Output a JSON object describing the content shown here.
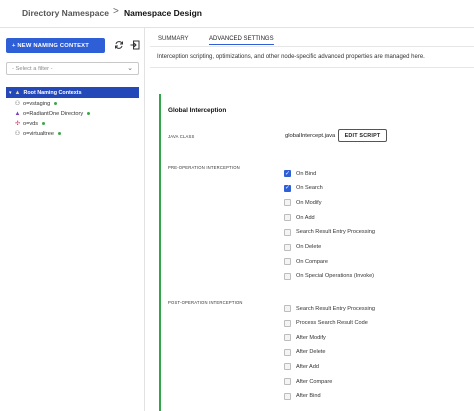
{
  "breadcrumb": {
    "parent": "Directory Namespace",
    "separator": ">",
    "current": "Namespace Design"
  },
  "left_panel": {
    "new_button": "+ NEW NAMING CONTEXT",
    "filter_placeholder": "- Select a filter -",
    "tree": {
      "root": "Root Naming Contexts",
      "items": [
        {
          "label": "o=vstaging",
          "icon": "node-icon",
          "status": "active"
        },
        {
          "label": "o=RadiantOne Directory",
          "icon": "purple-triangle-icon",
          "status": "active"
        },
        {
          "label": "o=vds",
          "icon": "plus-node-icon",
          "status": "active"
        },
        {
          "label": "o=virtualtree",
          "icon": "node-icon",
          "status": "active"
        }
      ]
    }
  },
  "tabs": [
    {
      "label": "SUMMARY",
      "active": false
    },
    {
      "label": "ADVANCED SETTINGS",
      "active": true
    }
  ],
  "description": "Interception scripting, optimizations, and other node-specific advanced properties are managed here.",
  "global_interception": {
    "title": "Global Interception",
    "java_class_label": "JAVA CLASS",
    "java_class_value": "globalIntercept.java",
    "edit_script_label": "EDIT SCRIPT",
    "pre_label": "PRE-OPERATION INTERCEPTION",
    "pre_operations": [
      {
        "label": "On Bind",
        "checked": true
      },
      {
        "label": "On Search",
        "checked": true
      },
      {
        "label": "On Modify",
        "checked": false
      },
      {
        "label": "On Add",
        "checked": false
      },
      {
        "label": "Search Result Entry Processing",
        "checked": false
      },
      {
        "label": "On Delete",
        "checked": false
      },
      {
        "label": "On Compare",
        "checked": false
      },
      {
        "label": "On Special Operations (Invoke)",
        "checked": false
      }
    ],
    "post_label": "POST-OPERATION INTERCEPTION",
    "post_operations": [
      {
        "label": "Search Result Entry Processing",
        "checked": false
      },
      {
        "label": "Process Search Result Code",
        "checked": false
      },
      {
        "label": "After Modify",
        "checked": false
      },
      {
        "label": "After Delete",
        "checked": false
      },
      {
        "label": "After Add",
        "checked": false
      },
      {
        "label": "After Compare",
        "checked": false
      },
      {
        "label": "After Bind",
        "checked": false
      }
    ]
  },
  "colors": {
    "accent": "#2f5fd6",
    "tree_selected": "#2548b8",
    "status_green": "#3aa84a",
    "section_bar": "#31a649"
  }
}
